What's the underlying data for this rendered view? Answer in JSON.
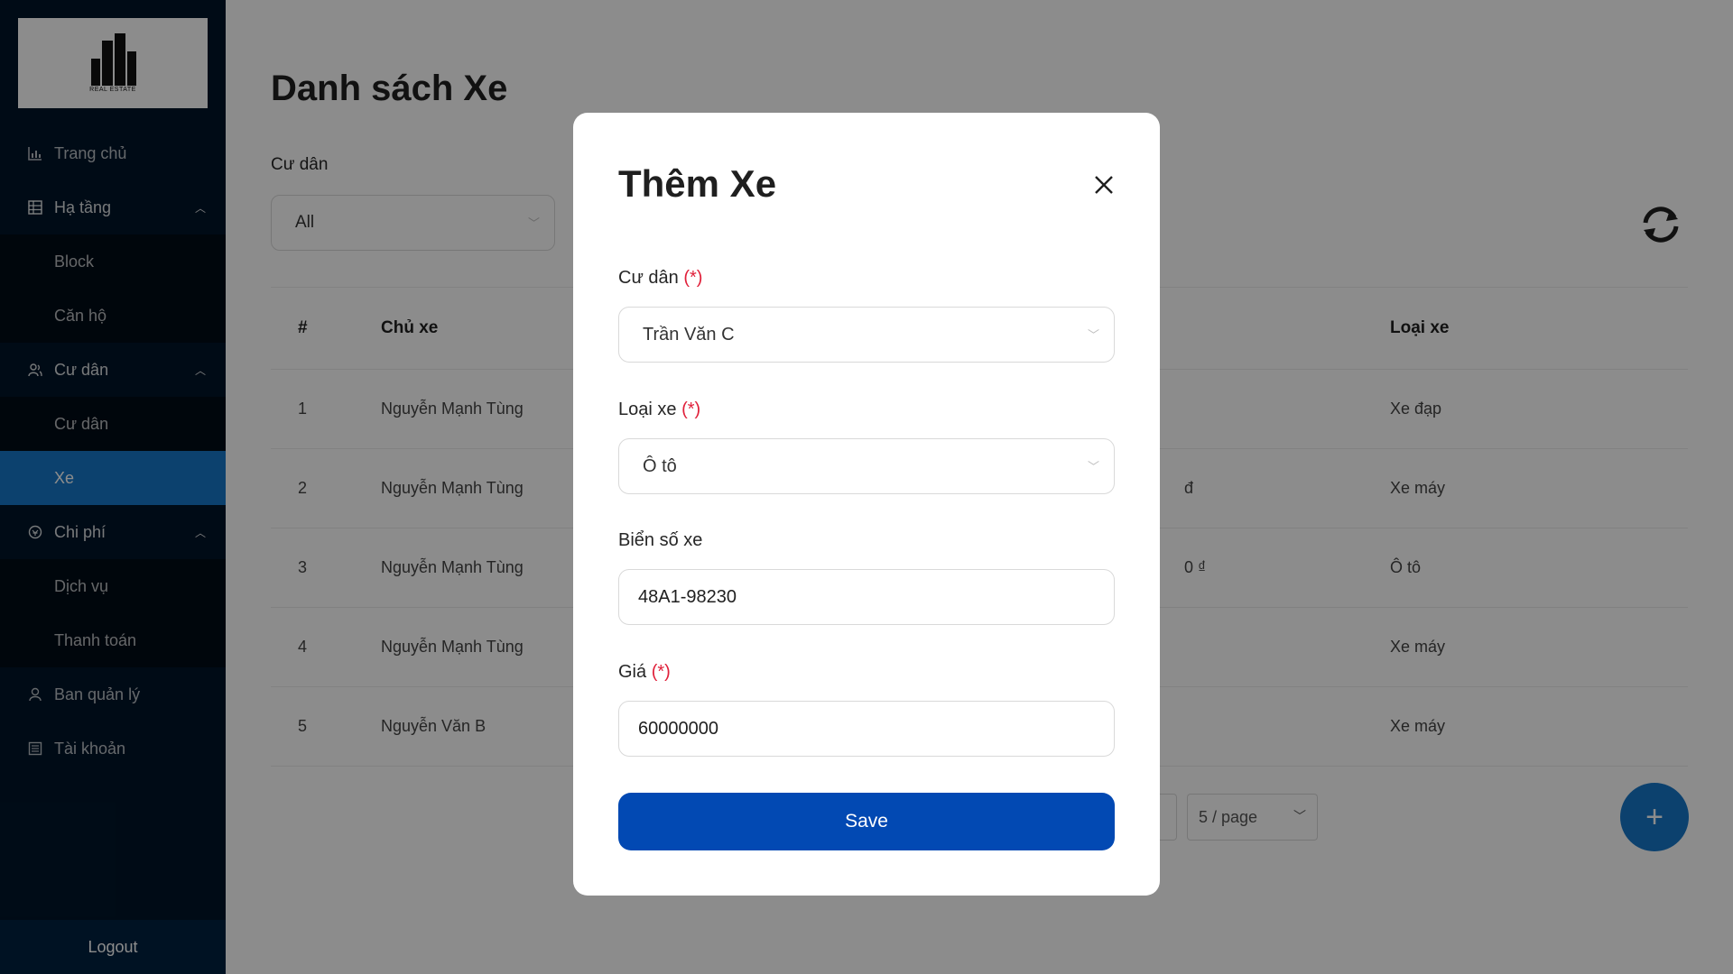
{
  "sidebar": {
    "logo_text": "REAL ESTATE",
    "menu": [
      {
        "label": "Trang chủ",
        "icon": "chart-icon"
      },
      {
        "label": "Hạ tầng",
        "icon": "table-icon",
        "children": [
          "Block",
          "Căn hộ"
        ]
      },
      {
        "label": "Cư dân",
        "icon": "users-icon",
        "children": [
          "Cư dân",
          "Xe"
        ]
      },
      {
        "label": "Chi phí",
        "icon": "money-icon",
        "children": [
          "Dịch vụ",
          "Thanh toán"
        ]
      },
      {
        "label": "Ban quản lý",
        "icon": "user-icon"
      },
      {
        "label": "Tài khoản",
        "icon": "account-icon"
      }
    ],
    "active_item": "Xe",
    "logout_label": "Logout"
  },
  "main": {
    "title": "Danh sách Xe",
    "filter": {
      "label": "Cư dân",
      "value": "All"
    },
    "table": {
      "headers": [
        "#",
        "Chủ xe",
        "Loại xe"
      ],
      "rows": [
        {
          "idx": "1",
          "owner": "Nguyễn Mạnh Tùng",
          "partial": "",
          "type": "Xe đạp"
        },
        {
          "idx": "2",
          "owner": "Nguyễn Mạnh Tùng",
          "partial": "đ",
          "type": "Xe máy"
        },
        {
          "idx": "3",
          "owner": "Nguyễn Mạnh Tùng",
          "partial": "0 ₫",
          "type": "Ô tô"
        },
        {
          "idx": "4",
          "owner": "Nguyễn Mạnh Tùng",
          "partial": "",
          "type": "Xe máy"
        },
        {
          "idx": "5",
          "owner": "Nguyễn Văn B",
          "partial": "",
          "type": "Xe máy"
        }
      ]
    },
    "pagination": {
      "page_size": "5 / page"
    },
    "add_button": "+"
  },
  "modal": {
    "title": "Thêm Xe",
    "required_mark": "(*)",
    "fields": {
      "resident": {
        "label": "Cư dân",
        "value": "Trần Văn C"
      },
      "vehicle_type": {
        "label": "Loại xe",
        "value": "Ô tô"
      },
      "plate": {
        "label": "Biển số xe",
        "value": "48A1-98230"
      },
      "price": {
        "label": "Giá",
        "value": "60000000"
      }
    },
    "save_label": "Save"
  },
  "colors": {
    "sidebar_bg": "#001529",
    "active_menu": "#1677c9",
    "primary_button": "#0249b3",
    "required": "#e0203a"
  }
}
